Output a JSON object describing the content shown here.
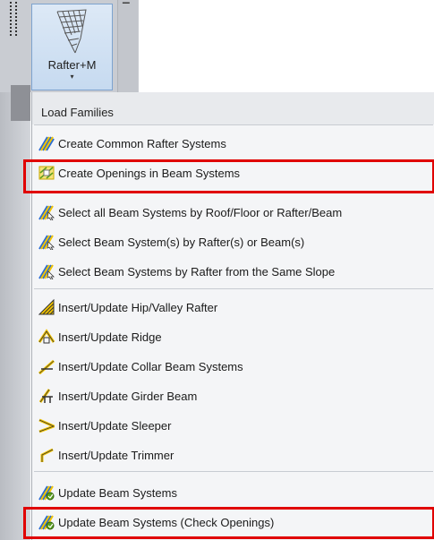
{
  "ribbon": {
    "button_label": "Rafter+M",
    "dropdown_arrow": "▾",
    "panel_glyph": "▔"
  },
  "menu": {
    "header": "Load Families",
    "groups": [
      {
        "items": [
          {
            "label": "Create Common Rafter Systems",
            "icon": "beam-system-icon"
          },
          {
            "label": "Create Openings in Beam Systems",
            "icon": "beam-opening-icon",
            "highlighted": true
          }
        ]
      },
      {
        "items": [
          {
            "label": "Select all Beam Systems by Roof/Floor or Rafter/Beam",
            "icon": "beam-select-icon"
          },
          {
            "label": "Select Beam System(s) by Rafter(s) or Beam(s)",
            "icon": "beam-select-icon"
          },
          {
            "label": "Select Beam Systems by Rafter from the Same Slope",
            "icon": "beam-select-icon"
          }
        ]
      },
      {
        "items": [
          {
            "label": "Insert/Update Hip/Valley Rafter",
            "icon": "hip-valley-icon"
          },
          {
            "label": "Insert/Update Ridge",
            "icon": "ridge-icon"
          },
          {
            "label": "Insert/Update Collar Beam Systems",
            "icon": "collar-beam-icon"
          },
          {
            "label": "Insert/Update Girder Beam",
            "icon": "girder-beam-icon"
          },
          {
            "label": "Insert/Update Sleeper",
            "icon": "sleeper-icon"
          },
          {
            "label": "Insert/Update Trimmer",
            "icon": "trimmer-icon"
          }
        ]
      },
      {
        "items": [
          {
            "label": "Update Beam Systems",
            "icon": "update-beam-icon"
          },
          {
            "label": "Update Beam Systems (Check Openings)",
            "icon": "update-beam-icon",
            "highlighted": true
          }
        ]
      }
    ]
  },
  "colors": {
    "highlight_border": "#e00000",
    "icon_yellow": "#f2c400",
    "icon_green": "#5a9e1e",
    "icon_blue": "#2a6bd1"
  }
}
